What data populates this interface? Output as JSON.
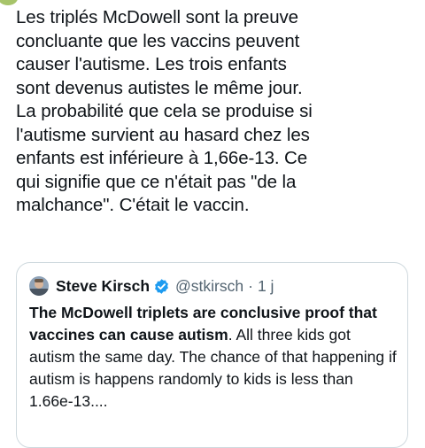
{
  "tweet": {
    "text": "Les triplés McDowell sont la preuve\nconcluante que les vaccins peuvent\ncauser l'autisme. Les trois enfants\nsont devenus autistes le même jour.\nLa probabilité que cela se produise si\nl'autisme survient au hasard chez les\nenfants est inférieure à 1,66e-13.  Ce\nqui signifie que ce n'était pas \"de la\nmalchance\". C'était le vaccin."
  },
  "quote": {
    "author_name": "Steve Kirsch",
    "handle": "@stkirsch",
    "separator": "·",
    "time": "1 j",
    "text_bold": "The McDowell triplets are conclusive proof that vaccines can cause autism",
    "text_rest": ". All three kids got autism the same day. The chance of that happening if autism is happens randomly to kids is less than 1.66e-13....",
    "verified_color": "#1d9bf0"
  }
}
